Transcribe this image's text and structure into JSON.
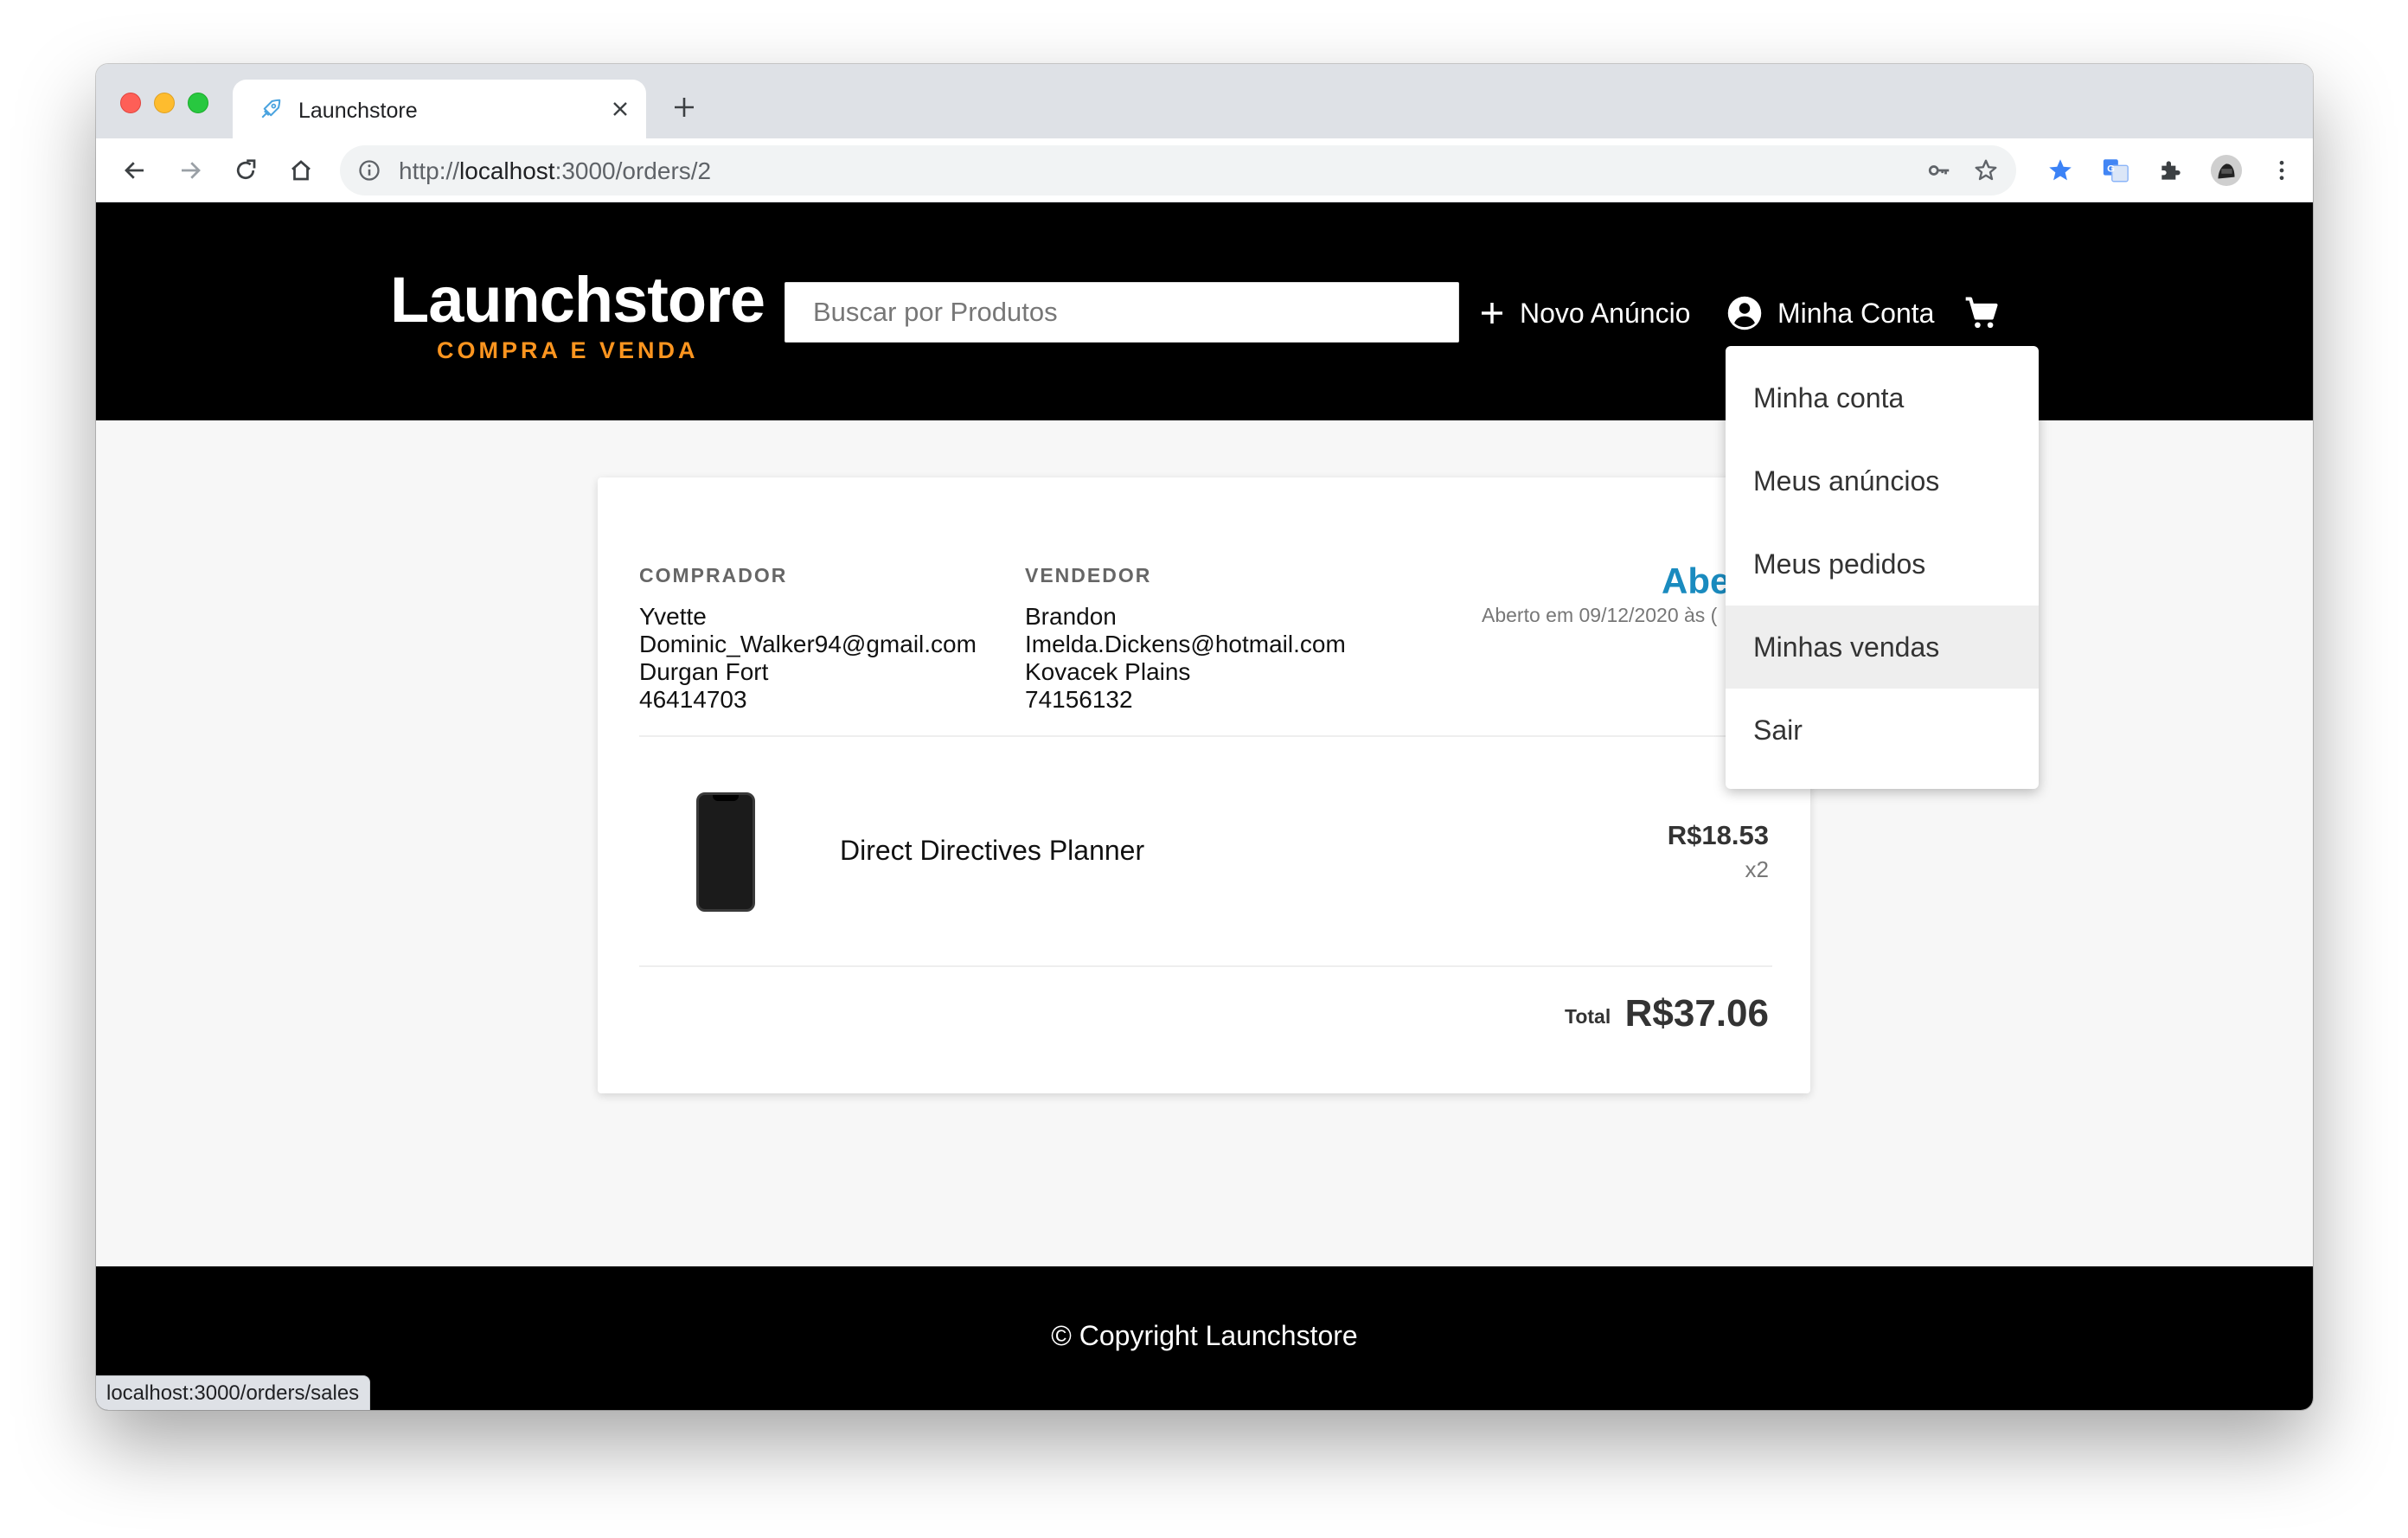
{
  "browser": {
    "tab_title": "Launchstore",
    "url_scheme": "http://",
    "url_host": "localhost",
    "url_path": ":3000/orders/2",
    "status_url": "localhost:3000/orders/sales"
  },
  "header": {
    "logo": "Launchstore",
    "tagline": "COMPRA E VENDA",
    "search_placeholder": "Buscar por Produtos",
    "new_ad": "Novo Anúncio",
    "account": "Minha Conta"
  },
  "account_menu": {
    "items": [
      "Minha conta",
      "Meus anúncios",
      "Meus pedidos",
      "Minhas vendas",
      "Sair"
    ],
    "active_index": 3
  },
  "order": {
    "buyer": {
      "label": "COMPRADOR",
      "name": "Yvette",
      "email": "Dominic_Walker94@gmail.com",
      "address": "Durgan Fort",
      "cep": "46414703"
    },
    "seller": {
      "label": "VENDEDOR",
      "name": "Brandon",
      "email": "Imelda.Dickens@hotmail.com",
      "address": "Kovacek Plains",
      "cep": "74156132"
    },
    "status": "Aber",
    "status_date": "Aberto em 09/12/2020 às (",
    "item": {
      "name": "Direct Directives Planner",
      "price": "R$18.53",
      "quantity": "x2"
    },
    "total_label": "Total",
    "total": "R$37.06"
  },
  "footer": {
    "text": "© Copyright Launchstore"
  },
  "colors": {
    "accent_orange": "#fd951f",
    "status_blue": "#1a8bbf",
    "header_bg": "#000000"
  }
}
